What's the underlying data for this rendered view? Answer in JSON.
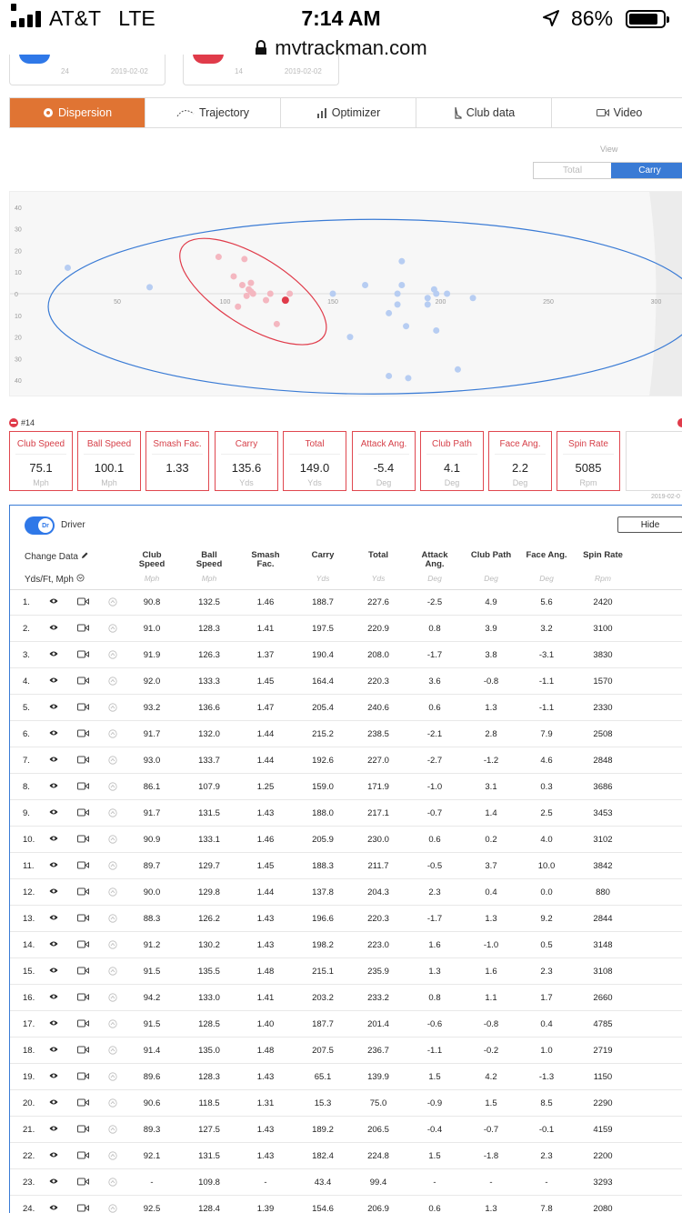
{
  "status_bar": {
    "carrier": "AT&T",
    "network": "LTE",
    "time": "7:14 AM",
    "battery": "86%",
    "battery_level": 0.86
  },
  "url": "mytrackman.com",
  "sessions": [
    {
      "count": "24",
      "date": "2019-02-02",
      "accent": "#2f78e8"
    },
    {
      "count": "14",
      "date": "2019-02-02",
      "accent": "#e03b4a"
    }
  ],
  "tabs": [
    {
      "label": "Dispersion",
      "icon": "target-icon",
      "active": true
    },
    {
      "label": "Trajectory",
      "icon": "trajectory-icon",
      "active": false
    },
    {
      "label": "Optimizer",
      "icon": "optimizer-icon",
      "active": false
    },
    {
      "label": "Club data",
      "icon": "club-icon",
      "active": false
    },
    {
      "label": "Video",
      "icon": "video-icon",
      "active": false
    }
  ],
  "view": {
    "label": "View",
    "options": [
      "Total",
      "Carry"
    ],
    "selected": "Carry"
  },
  "chart_data": {
    "type": "scatter",
    "x_ticks": [
      "50",
      "100",
      "150",
      "200",
      "250",
      "300"
    ],
    "y_ticks": [
      "40",
      "30",
      "20",
      "10",
      "0",
      "10",
      "20",
      "30",
      "40"
    ],
    "xlim": [
      -100,
      345
    ],
    "ylim": [
      -44,
      44
    ],
    "colors": {
      "session_a": "#3a7bd5",
      "session_b": "#e03b4a"
    },
    "series": [
      {
        "points": [
          [
            27,
            12
          ],
          [
            65,
            3
          ],
          [
            150,
            0
          ],
          [
            158,
            -20
          ],
          [
            165,
            4
          ],
          [
            176,
            -9
          ],
          [
            176,
            -38
          ],
          [
            180,
            0
          ],
          [
            180,
            -5
          ],
          [
            182,
            4
          ],
          [
            182,
            15
          ],
          [
            184,
            -15
          ],
          [
            185,
            -39
          ],
          [
            194,
            -5
          ],
          [
            194,
            -2
          ],
          [
            198,
            -17
          ],
          [
            198,
            0
          ],
          [
            197,
            2
          ],
          [
            203,
            0
          ],
          [
            208,
            -35
          ],
          [
            215,
            -2
          ]
        ]
      },
      {
        "points": [
          [
            97,
            17
          ],
          [
            104,
            8
          ],
          [
            106,
            -6
          ],
          [
            108,
            4
          ],
          [
            109,
            16
          ],
          [
            110,
            -1
          ],
          [
            111,
            2
          ],
          [
            112,
            5
          ],
          [
            112,
            1
          ],
          [
            113,
            0
          ],
          [
            119,
            -3
          ],
          [
            121,
            0
          ],
          [
            124,
            -14
          ],
          [
            130,
            0
          ]
        ],
        "highlight": [
          128,
          -3
        ]
      }
    ]
  },
  "shot": {
    "label": "#14",
    "stats": [
      {
        "label": "Club Speed",
        "value": "75.1",
        "unit": "Mph"
      },
      {
        "label": "Ball Speed",
        "value": "100.1",
        "unit": "Mph"
      },
      {
        "label": "Smash Fac.",
        "value": "1.33",
        "unit": ""
      },
      {
        "label": "Carry",
        "value": "135.6",
        "unit": "Yds"
      },
      {
        "label": "Total",
        "value": "149.0",
        "unit": "Yds"
      },
      {
        "label": "Attack Ang.",
        "value": "-5.4",
        "unit": "Deg"
      },
      {
        "label": "Club Path",
        "value": "4.1",
        "unit": "Deg"
      },
      {
        "label": "Face Ang.",
        "value": "2.2",
        "unit": "Deg"
      },
      {
        "label": "Spin Rate",
        "value": "5085",
        "unit": "Rpm"
      }
    ],
    "date": "2019-02-0"
  },
  "table": {
    "club_badge": "Dr",
    "club_name": "Driver",
    "hide_label": "Hide",
    "change_data": "Change Data",
    "units_label": "Yds/Ft, Mph",
    "columns": [
      {
        "l1": "Club",
        "l2": "Speed",
        "unit": "Mph"
      },
      {
        "l1": "Ball",
        "l2": "Speed",
        "unit": "Mph"
      },
      {
        "l1": "Smash",
        "l2": "Fac.",
        "unit": ""
      },
      {
        "l1": "Carry",
        "l2": "",
        "unit": "Yds"
      },
      {
        "l1": "Total",
        "l2": "",
        "unit": "Yds"
      },
      {
        "l1": "Attack",
        "l2": "Ang.",
        "unit": "Deg"
      },
      {
        "l1": "Club Path",
        "l2": "",
        "unit": "Deg"
      },
      {
        "l1": "Face Ang.",
        "l2": "",
        "unit": "Deg"
      },
      {
        "l1": "Spin Rate",
        "l2": "",
        "unit": "Rpm"
      }
    ],
    "rows": [
      [
        "1.",
        "90.8",
        "132.5",
        "1.46",
        "188.7",
        "227.6",
        "-2.5",
        "4.9",
        "5.6",
        "2420"
      ],
      [
        "2.",
        "91.0",
        "128.3",
        "1.41",
        "197.5",
        "220.9",
        "0.8",
        "3.9",
        "3.2",
        "3100"
      ],
      [
        "3.",
        "91.9",
        "126.3",
        "1.37",
        "190.4",
        "208.0",
        "-1.7",
        "3.8",
        "-3.1",
        "3830"
      ],
      [
        "4.",
        "92.0",
        "133.3",
        "1.45",
        "164.4",
        "220.3",
        "3.6",
        "-0.8",
        "-1.1",
        "1570"
      ],
      [
        "5.",
        "93.2",
        "136.6",
        "1.47",
        "205.4",
        "240.6",
        "0.6",
        "1.3",
        "-1.1",
        "2330"
      ],
      [
        "6.",
        "91.7",
        "132.0",
        "1.44",
        "215.2",
        "238.5",
        "-2.1",
        "2.8",
        "7.9",
        "2508"
      ],
      [
        "7.",
        "93.0",
        "133.7",
        "1.44",
        "192.6",
        "227.0",
        "-2.7",
        "-1.2",
        "4.6",
        "2848"
      ],
      [
        "8.",
        "86.1",
        "107.9",
        "1.25",
        "159.0",
        "171.9",
        "-1.0",
        "3.1",
        "0.3",
        "3686"
      ],
      [
        "9.",
        "91.7",
        "131.5",
        "1.43",
        "188.0",
        "217.1",
        "-0.7",
        "1.4",
        "2.5",
        "3453"
      ],
      [
        "10.",
        "90.9",
        "133.1",
        "1.46",
        "205.9",
        "230.0",
        "0.6",
        "0.2",
        "4.0",
        "3102"
      ],
      [
        "11.",
        "89.7",
        "129.7",
        "1.45",
        "188.3",
        "211.7",
        "-0.5",
        "3.7",
        "10.0",
        "3842"
      ],
      [
        "12.",
        "90.0",
        "129.8",
        "1.44",
        "137.8",
        "204.3",
        "2.3",
        "0.4",
        "0.0",
        "880"
      ],
      [
        "13.",
        "88.3",
        "126.2",
        "1.43",
        "196.6",
        "220.3",
        "-1.7",
        "1.3",
        "9.2",
        "2844"
      ],
      [
        "14.",
        "91.2",
        "130.2",
        "1.43",
        "198.2",
        "223.0",
        "1.6",
        "-1.0",
        "0.5",
        "3148"
      ],
      [
        "15.",
        "91.5",
        "135.5",
        "1.48",
        "215.1",
        "235.9",
        "1.3",
        "1.6",
        "2.3",
        "3108"
      ],
      [
        "16.",
        "94.2",
        "133.0",
        "1.41",
        "203.2",
        "233.2",
        "0.8",
        "1.1",
        "1.7",
        "2660"
      ],
      [
        "17.",
        "91.5",
        "128.5",
        "1.40",
        "187.7",
        "201.4",
        "-0.6",
        "-0.8",
        "0.4",
        "4785"
      ],
      [
        "18.",
        "91.4",
        "135.0",
        "1.48",
        "207.5",
        "236.7",
        "-1.1",
        "-0.2",
        "1.0",
        "2719"
      ],
      [
        "19.",
        "89.6",
        "128.3",
        "1.43",
        "65.1",
        "139.9",
        "1.5",
        "4.2",
        "-1.3",
        "1150"
      ],
      [
        "20.",
        "90.6",
        "118.5",
        "1.31",
        "15.3",
        "75.0",
        "-0.9",
        "1.5",
        "8.5",
        "2290"
      ],
      [
        "21.",
        "89.3",
        "127.5",
        "1.43",
        "189.2",
        "206.5",
        "-0.4",
        "-0.7",
        "-0.1",
        "4159"
      ],
      [
        "22.",
        "92.1",
        "131.5",
        "1.43",
        "182.4",
        "224.8",
        "1.5",
        "-1.8",
        "2.3",
        "2200"
      ],
      [
        "23.",
        "-",
        "109.8",
        "-",
        "43.4",
        "99.4",
        "-",
        "-",
        "-",
        "3293"
      ],
      [
        "24.",
        "92.5",
        "128.4",
        "1.39",
        "154.6",
        "206.9",
        "0.6",
        "1.3",
        "7.8",
        "2080"
      ]
    ]
  }
}
